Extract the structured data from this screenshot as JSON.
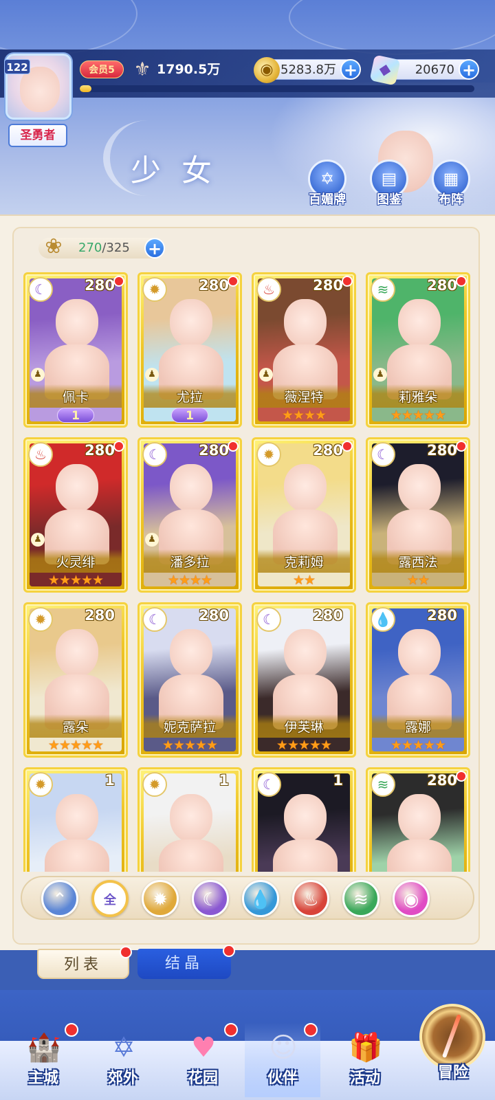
{
  "header": {
    "level": "122",
    "title_badge": "圣勇者",
    "vip": "会员5",
    "power": "1790.5万",
    "xp_progress": 0.03,
    "gold": "5283.8万",
    "gems": "20670",
    "page_title": "少女",
    "buttons": [
      {
        "label": "百媚牌",
        "icon": "hexagram-card-icon"
      },
      {
        "label": "图鉴",
        "icon": "book-icon"
      },
      {
        "label": "布阵",
        "icon": "grid-icon"
      }
    ]
  },
  "capacity": {
    "current": "270",
    "max": "/325"
  },
  "cards": [
    {
      "name": "佩卡",
      "count": "280",
      "element": "moon",
      "stars": 0,
      "rank": "1",
      "pawn": true,
      "dot": true,
      "hair": "#8a5fc4",
      "bg": "#b99be0"
    },
    {
      "name": "尤拉",
      "count": "280",
      "element": "sun",
      "stars": 0,
      "rank": "1",
      "pawn": true,
      "dot": true,
      "hair": "#e8c79a",
      "bg": "#bfe3f0"
    },
    {
      "name": "薇涅特",
      "count": "280",
      "element": "fire",
      "stars": 4,
      "rank": "",
      "pawn": true,
      "dot": true,
      "hair": "#7b4a30",
      "bg": "#c4574a"
    },
    {
      "name": "莉雅朵",
      "count": "280",
      "element": "wind",
      "stars": 5,
      "rank": "",
      "pawn": true,
      "dot": true,
      "hair": "#4fb46a",
      "bg": "#8ab88a"
    },
    {
      "name": "火灵绯",
      "count": "280",
      "element": "fire",
      "stars": 5,
      "rank": "",
      "pawn": true,
      "dot": true,
      "hair": "#d02a2a",
      "bg": "#7a2a2a"
    },
    {
      "name": "潘多拉",
      "count": "280",
      "element": "moon",
      "stars": 4,
      "rank": "",
      "pawn": true,
      "dot": true,
      "hair": "#7c58c8",
      "bg": "#d7c09a"
    },
    {
      "name": "克莉姆",
      "count": "280",
      "element": "sun",
      "stars": 2,
      "rank": "",
      "pawn": false,
      "dot": true,
      "hair": "#f3dc8a",
      "bg": "#efe7c8"
    },
    {
      "name": "露西法",
      "count": "280",
      "element": "moon",
      "stars": 2,
      "rank": "",
      "pawn": false,
      "dot": true,
      "hair": "#1d1d2c",
      "bg": "#c9b27a"
    },
    {
      "name": "露朵",
      "count": "280",
      "element": "sun",
      "stars": 5,
      "rank": "",
      "pawn": false,
      "dot": false,
      "hair": "#e9c98c",
      "bg": "#f0e8d0"
    },
    {
      "name": "妮克萨拉",
      "count": "280",
      "element": "moon",
      "stars": 5,
      "rank": "",
      "pawn": false,
      "dot": false,
      "hair": "#d8dcf0",
      "bg": "#5a5a88"
    },
    {
      "name": "伊芙琳",
      "count": "280",
      "element": "moon",
      "stars": 5,
      "rank": "",
      "pawn": false,
      "dot": false,
      "hair": "#eef0f6",
      "bg": "#3b2a2a"
    },
    {
      "name": "露娜",
      "count": "280",
      "element": "water",
      "stars": 5,
      "rank": "",
      "pawn": false,
      "dot": false,
      "hair": "#3f63c4",
      "bg": "#6f86d0"
    },
    {
      "name": "",
      "count": "1",
      "element": "sun",
      "stars": 0,
      "rank": "",
      "pawn": false,
      "dot": false,
      "hair": "#c7d7f2",
      "bg": "#e6eef8"
    },
    {
      "name": "",
      "count": "1",
      "element": "sun",
      "stars": 0,
      "rank": "",
      "pawn": false,
      "dot": false,
      "hair": "#f2f2f2",
      "bg": "#e8dcc6"
    },
    {
      "name": "",
      "count": "1",
      "element": "moon",
      "stars": 0,
      "rank": "",
      "pawn": false,
      "dot": false,
      "hair": "#1c1a24",
      "bg": "#4a3a56"
    },
    {
      "name": "",
      "count": "280",
      "element": "wind",
      "stars": 0,
      "rank": "",
      "pawn": false,
      "dot": true,
      "hair": "#2c2c2c",
      "bg": "#9ed2a8"
    }
  ],
  "filters": [
    {
      "name": "special",
      "icon": "arrow-up-icon",
      "color": "#5b86d6"
    },
    {
      "name": "all",
      "label": "全",
      "color": "#ffffff"
    },
    {
      "name": "sun",
      "icon": "sun-icon",
      "color": "#e0a93a"
    },
    {
      "name": "moon",
      "icon": "moon-icon",
      "color": "#8a58d2"
    },
    {
      "name": "water",
      "icon": "water-drop-icon",
      "color": "#3598d8"
    },
    {
      "name": "fire",
      "icon": "fire-icon",
      "color": "#d8443a"
    },
    {
      "name": "wind",
      "icon": "wind-icon",
      "color": "#3aa85a"
    },
    {
      "name": "heart",
      "icon": "heart-orb-icon",
      "color": "#e04cc4"
    }
  ],
  "tabs": [
    {
      "label": "列表",
      "active": true
    },
    {
      "label": "结晶",
      "active": false
    }
  ],
  "nav": [
    {
      "label": "主城",
      "icon": "castle-icon",
      "dot": true
    },
    {
      "label": "郊外",
      "icon": "portal-icon",
      "dot": false
    },
    {
      "label": "花园",
      "icon": "heart-icon",
      "dot": true
    },
    {
      "label": "伙伴",
      "icon": "partner-icon",
      "dot": true,
      "active": true
    },
    {
      "label": "活动",
      "icon": "gift-icon",
      "dot": false
    },
    {
      "label": "冒险",
      "icon": "compass-icon",
      "dot": false
    }
  ]
}
